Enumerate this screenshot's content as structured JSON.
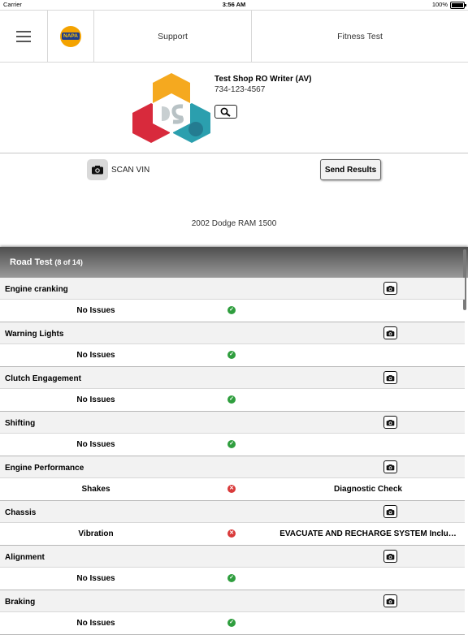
{
  "status_bar": {
    "carrier": "Carrier",
    "time": "3:56 AM",
    "battery": "100%"
  },
  "nav": {
    "brand": "NAPA",
    "support_label": "Support",
    "fitness_label": "Fitness Test"
  },
  "shop": {
    "name": "Test Shop RO Writer (AV)",
    "phone": "734-123-4567"
  },
  "actions": {
    "scan_label": "SCAN VIN",
    "send_label": "Send Results"
  },
  "vehicle": "2002 Dodge RAM 1500",
  "section": {
    "title": "Road Test",
    "count": "(8 of 14)"
  },
  "items": [
    {
      "name": "Engine cranking",
      "issue": "No Issues",
      "status": "ok",
      "recommendation": ""
    },
    {
      "name": "Warning Lights",
      "issue": "No Issues",
      "status": "ok",
      "recommendation": ""
    },
    {
      "name": "Clutch Engagement",
      "issue": "No Issues",
      "status": "ok",
      "recommendation": ""
    },
    {
      "name": "Shifting",
      "issue": "No Issues",
      "status": "ok",
      "recommendation": ""
    },
    {
      "name": "Engine Performance",
      "issue": "Shakes",
      "status": "bad",
      "recommendation": "Diagnostic Check"
    },
    {
      "name": "Chassis",
      "issue": "Vibration",
      "status": "bad",
      "recommendation": "EVACUATE AND RECHARGE SYSTEM Inclu…"
    },
    {
      "name": "Alignment",
      "issue": "No Issues",
      "status": "ok",
      "recommendation": ""
    },
    {
      "name": "Braking",
      "issue": "No Issues",
      "status": "ok",
      "recommendation": ""
    }
  ],
  "colors": {
    "ok": "#2f9e3e",
    "bad": "#d93a3a",
    "header_dark": "#4e4e4e"
  }
}
